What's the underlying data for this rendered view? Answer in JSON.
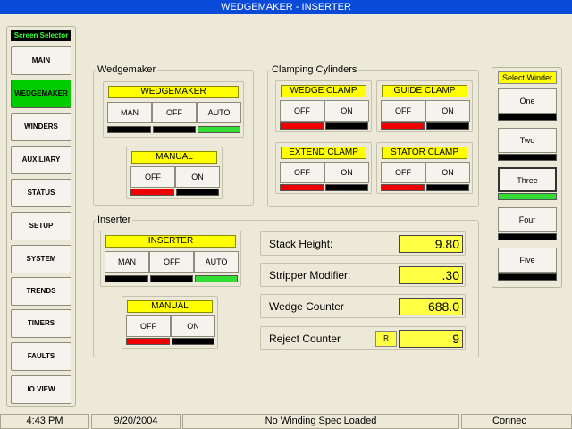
{
  "window": {
    "title": "WEDGEMAKER - INSERTER"
  },
  "nav": {
    "header": "Screen Selector",
    "items": [
      "MAIN",
      "WEDGEMAKER",
      "WINDERS",
      "AUXILIARY",
      "STATUS",
      "SETUP",
      "SYSTEM",
      "TRENDS",
      "TIMERS",
      "FAULTS",
      "IO VIEW"
    ],
    "active": "WEDGEMAKER"
  },
  "wedgemaker": {
    "group_label": "Wedgemaker",
    "mode": {
      "title": "WEDGEMAKER",
      "buttons": [
        "MAN",
        "OFF",
        "AUTO"
      ],
      "active": "AUTO"
    },
    "manual": {
      "title": "MANUAL",
      "buttons": [
        "OFF",
        "ON"
      ],
      "active": "OFF"
    }
  },
  "clamping": {
    "group_label": "Clamping Cylinders",
    "wedge_clamp": {
      "title": "WEDGE CLAMP",
      "buttons": [
        "OFF",
        "ON"
      ],
      "active": "OFF"
    },
    "guide_clamp": {
      "title": "GUIDE CLAMP",
      "buttons": [
        "OFF",
        "ON"
      ],
      "active": "OFF"
    },
    "extend_clamp": {
      "title": "EXTEND CLAMP",
      "buttons": [
        "OFF",
        "ON"
      ],
      "active": "OFF"
    },
    "stator_clamp": {
      "title": "STATOR CLAMP",
      "buttons": [
        "OFF",
        "ON"
      ],
      "active": "OFF"
    }
  },
  "inserter": {
    "group_label": "Inserter",
    "mode": {
      "title": "INSERTER",
      "buttons": [
        "MAN",
        "OFF",
        "AUTO"
      ],
      "active": "AUTO"
    },
    "manual": {
      "title": "MANUAL",
      "buttons": [
        "OFF",
        "ON"
      ],
      "active": "OFF"
    },
    "stack_height": {
      "label": "Stack Height:",
      "value": "9.80"
    },
    "stripper_modifier": {
      "label": "Stripper Modifier:",
      "value": ".30"
    },
    "wedge_counter": {
      "label": "Wedge Counter",
      "value": "688.0"
    },
    "reject_counter": {
      "label": "Reject Counter",
      "value": "9",
      "reset_label": "R"
    }
  },
  "winder": {
    "header": "Select Winder",
    "options": [
      "One",
      "Two",
      "Three",
      "Four",
      "Five"
    ],
    "selected": "Three"
  },
  "status": {
    "time": "4:43 PM",
    "date": "9/20/2004",
    "message": "No Winding Spec Loaded",
    "connection": "Connec"
  },
  "colors": {
    "active_green": "#00cc00",
    "indicator_red": "#ee0000",
    "field_yellow": "#ffff44",
    "title_blue": "#0a4ad8"
  }
}
